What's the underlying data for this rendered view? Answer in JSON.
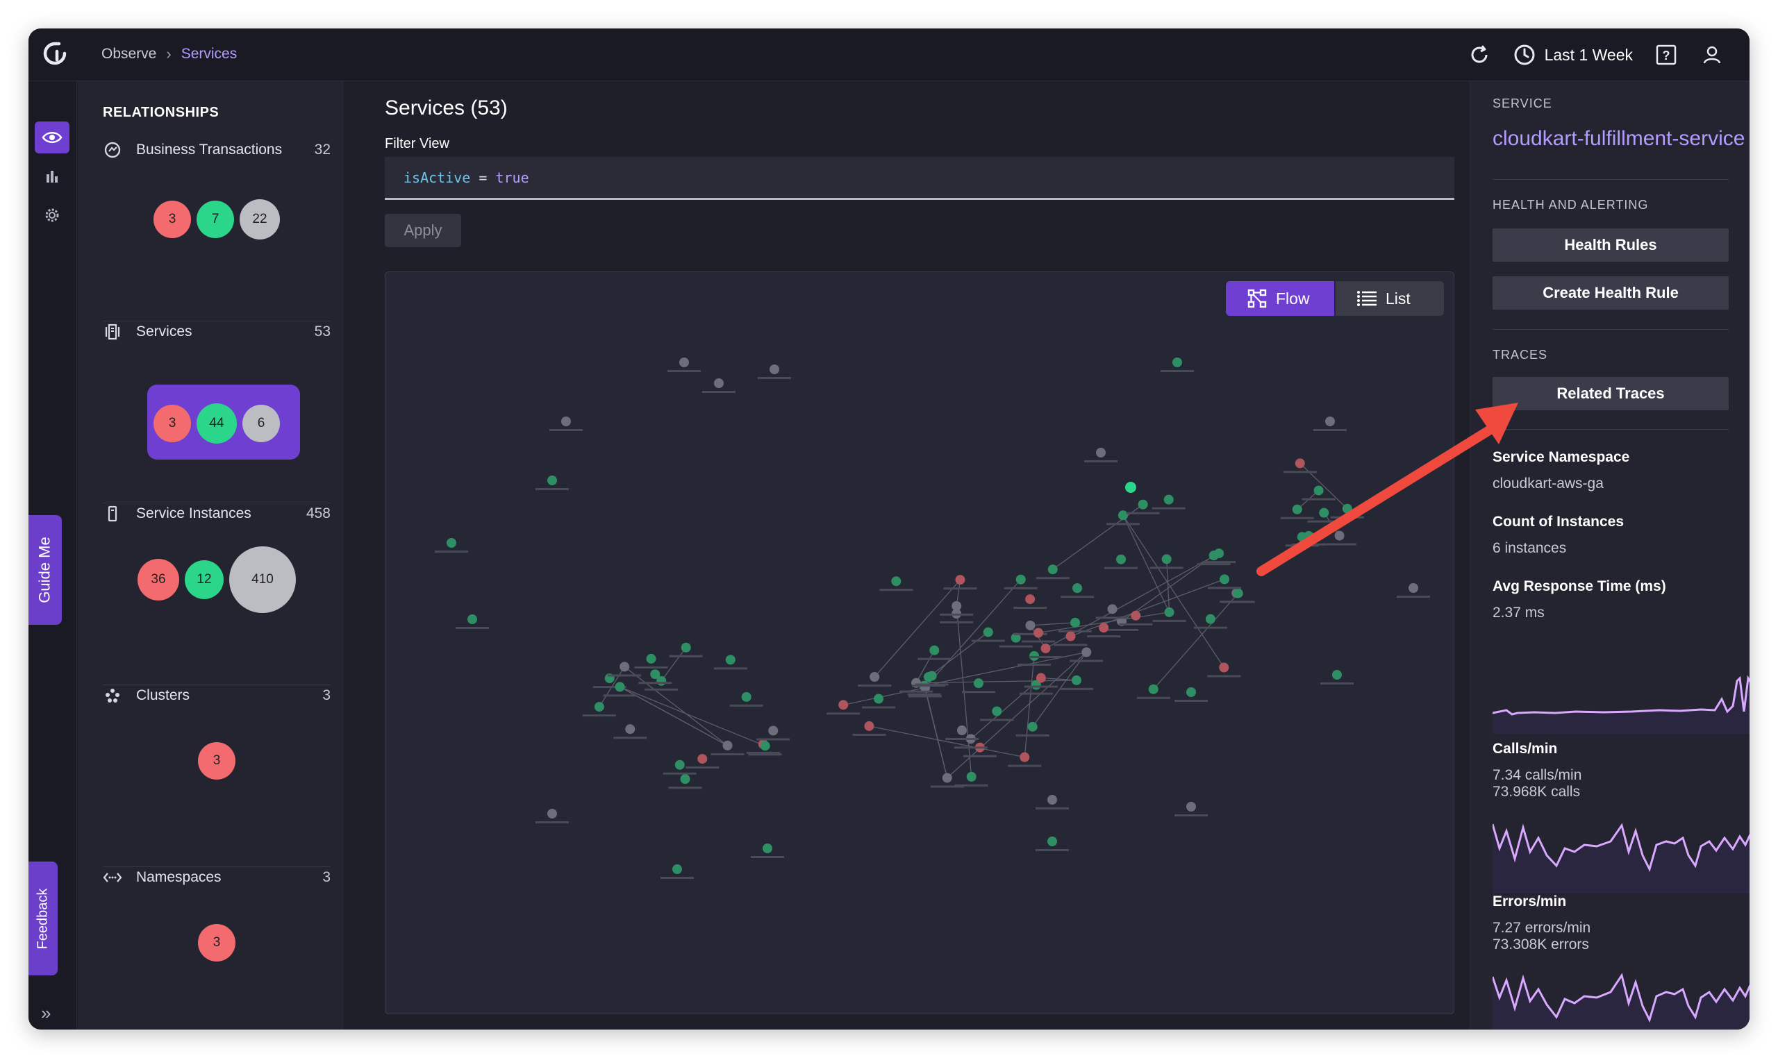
{
  "header": {
    "breadcrumb_root": "Observe",
    "breadcrumb_sep": "›",
    "breadcrumb_current": "Services",
    "time_range": "Last 1 Week"
  },
  "rail": {
    "guide_me": "Guide Me",
    "feedback": "Feedback",
    "expand": "»"
  },
  "relationships": {
    "title": "RELATIONSHIPS",
    "sections": [
      {
        "label": "Business Transactions",
        "count": "32",
        "bubbles": [
          "3",
          "7",
          "22"
        ]
      },
      {
        "label": "Services",
        "count": "53",
        "bubbles": [
          "3",
          "44",
          "6"
        ]
      },
      {
        "label": "Service Instances",
        "count": "458",
        "bubbles": [
          "36",
          "12",
          "410"
        ]
      },
      {
        "label": "Clusters",
        "count": "3",
        "bubbles": [
          "3"
        ]
      },
      {
        "label": "Namespaces",
        "count": "3",
        "bubbles": [
          "3"
        ]
      }
    ]
  },
  "main": {
    "title": "Services (53)",
    "filter_label": "Filter View",
    "filter_key": "isActive",
    "filter_op": "=",
    "filter_val": "true",
    "apply": "Apply",
    "flow": "Flow",
    "list": "List"
  },
  "detail": {
    "service_caption": "SERVICE",
    "service_name": "cloudkart-fulfillment-service",
    "health_caption": "HEALTH AND ALERTING",
    "health_rules": "Health Rules",
    "create_health_rule": "Create Health Rule",
    "traces_caption": "TRACES",
    "related_traces": "Related Traces",
    "namespace_label": "Service Namespace",
    "namespace_value": "cloudkart-aws-ga",
    "instances_label": "Count of Instances",
    "instances_value": "6 instances",
    "response_label": "Avg Response Time (ms)",
    "response_value": "2.37 ms",
    "calls_label": "Calls/min",
    "calls_value1": "7.34 calls/min",
    "calls_value2": "73.968K calls",
    "errors_label": "Errors/min",
    "errors_value1": "7.27 errors/min",
    "errors_value2": "73.308K errors"
  },
  "colors": {
    "accent": "#6f3fd1",
    "link": "#b49cff",
    "healthy": "#2bd68b",
    "critical": "#f36b6f",
    "unknown": "#bcbcc3",
    "annotation_arrow": "#f0493e"
  }
}
